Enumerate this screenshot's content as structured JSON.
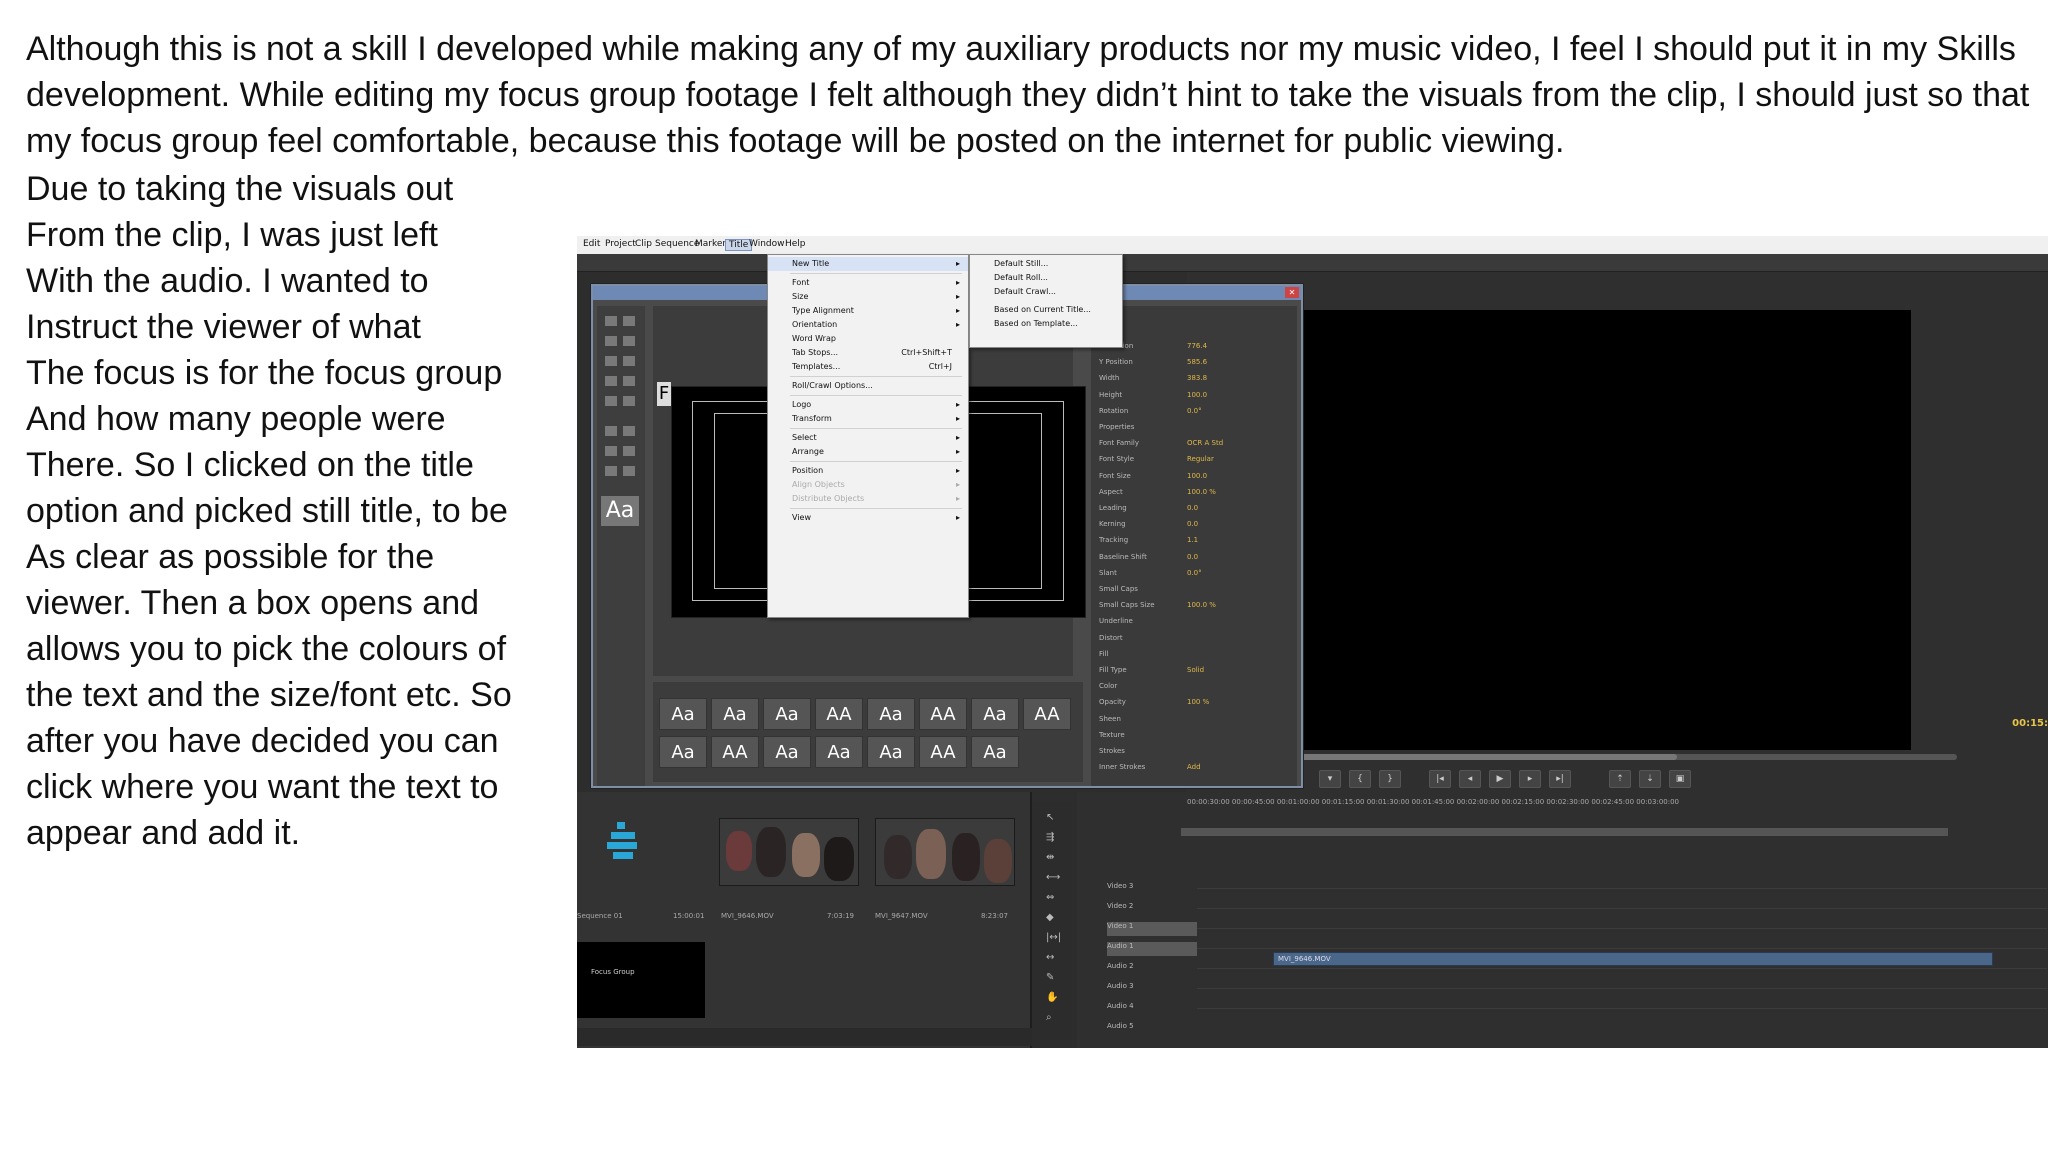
{
  "intro": "Although this is not a skill I developed while making any of my auxiliary products nor my music video, I feel I should put it in my Skills development. While editing my focus group footage I felt although they didn’t hint to take the visuals from the clip, I should just so that my focus group feel comfortable, because this footage will be posted on the internet for public viewing.",
  "side_lines": [
    "Due to taking the visuals out",
    "From the clip, I was just left",
    "With the audio. I wanted to",
    "Instruct the viewer of what",
    "The focus is for the focus group",
    "And how many people were",
    "There. So I clicked on the title",
    "option and picked still title, to be",
    "As clear as possible for the",
    "viewer. Then a box opens and",
    "allows you to pick the colours of",
    "the text and the size/font etc. So",
    "after you have decided you can",
    "click where you want the text to",
    "appear and add it."
  ],
  "screenshot": {
    "menubar": [
      "Edit",
      "Project",
      "Clip",
      "Sequence",
      "Marker",
      "Title",
      "Window",
      "Help"
    ],
    "title_menu": [
      {
        "label": "New Title",
        "arrow": true,
        "highlight": true
      },
      {
        "sep": true
      },
      {
        "label": "Font",
        "arrow": true
      },
      {
        "label": "Size",
        "arrow": true
      },
      {
        "label": "Type Alignment",
        "arrow": true
      },
      {
        "label": "Orientation",
        "arrow": true
      },
      {
        "label": "Word Wrap"
      },
      {
        "label": "Tab Stops...",
        "shortcut": "Ctrl+Shift+T"
      },
      {
        "label": "Templates...",
        "shortcut": "Ctrl+J"
      },
      {
        "sep": true
      },
      {
        "label": "Roll/Crawl Options..."
      },
      {
        "sep": true
      },
      {
        "label": "Logo",
        "arrow": true
      },
      {
        "label": "Transform",
        "arrow": true
      },
      {
        "sep": true
      },
      {
        "label": "Select",
        "arrow": true
      },
      {
        "label": "Arrange",
        "arrow": true
      },
      {
        "sep": true
      },
      {
        "label": "Position",
        "arrow": true
      },
      {
        "label": "Align Objects",
        "arrow": true,
        "disabled": true
      },
      {
        "label": "Distribute Objects",
        "arrow": true,
        "disabled": true
      },
      {
        "sep": true
      },
      {
        "label": "View",
        "arrow": true
      }
    ],
    "new_title_submenu": [
      "Default Still...",
      "Default Roll...",
      "Default Crawl...",
      "Based on Current Title...",
      "Based on Template..."
    ],
    "properties": [
      {
        "label": "X Position",
        "value": "776.4"
      },
      {
        "label": "Y Position",
        "value": "585.6"
      },
      {
        "label": "Width",
        "value": "383.8"
      },
      {
        "label": "Height",
        "value": "100.0"
      },
      {
        "label": "Rotation",
        "value": "0.0°"
      },
      {
        "label": "Properties",
        "value": ""
      },
      {
        "label": "Font Family",
        "value": "OCR A Std"
      },
      {
        "label": "Font Style",
        "value": "Regular"
      },
      {
        "label": "Font Size",
        "value": "100.0"
      },
      {
        "label": "Aspect",
        "value": "100.0 %"
      },
      {
        "label": "Leading",
        "value": "0.0"
      },
      {
        "label": "Kerning",
        "value": "0.0"
      },
      {
        "label": "Tracking",
        "value": "1.1"
      },
      {
        "label": "Baseline Shift",
        "value": "0.0"
      },
      {
        "label": "Slant",
        "value": "0.0°"
      },
      {
        "label": "Small Caps",
        "value": ""
      },
      {
        "label": "Small Caps Size",
        "value": "100.0 %"
      },
      {
        "label": "Underline",
        "value": ""
      },
      {
        "label": "Distort",
        "value": ""
      },
      {
        "label": "Fill",
        "value": ""
      },
      {
        "label": "Fill Type",
        "value": "Solid"
      },
      {
        "label": "Color",
        "value": ""
      },
      {
        "label": "Opacity",
        "value": "100 %"
      },
      {
        "label": "Sheen",
        "value": ""
      },
      {
        "label": "Texture",
        "value": ""
      },
      {
        "label": "Strokes",
        "value": ""
      },
      {
        "label": "Inner Strokes",
        "value": "Add"
      }
    ],
    "style_swatches": [
      "Aa",
      "Aa",
      "Aa",
      "AA",
      "Aa",
      "AA",
      "Aa",
      "AA",
      "Aa",
      "AA",
      "Aa",
      "Aa",
      "Aa",
      "AA",
      "Aa"
    ],
    "tool_aa": "Aa",
    "canvas_letter": "F",
    "monitor_timecode": "00:15:",
    "project": {
      "clips": [
        {
          "name": "MVI_9646.MOV",
          "duration": "7:03:19"
        },
        {
          "name": "MVI_9647.MOV",
          "duration": "8:23:07"
        }
      ],
      "sequence_name": "Sequence 01",
      "sequence_duration": "15:00:01",
      "preview_text": "Focus Group"
    },
    "ruler": "00:00:30:00   00:00:45:00   00:01:00:00   00:01:15:00   00:01:30:00   00:01:45:00   00:02:00:00   00:02:15:00   00:02:30:00   00:02:45:00   00:03:00:00",
    "tracks": [
      "Video 3",
      "Video 2",
      "Video 1",
      "Audio 1",
      "Audio 2",
      "Audio 3",
      "Audio 4",
      "Audio 5"
    ],
    "audio_clip": "MVI_9646.MOV",
    "colors": {
      "title_highlight": "#c9d6ea",
      "audio_clip": "#4a6688",
      "timecode": "#e8c54a",
      "prop_value": "#e0b84a"
    }
  }
}
